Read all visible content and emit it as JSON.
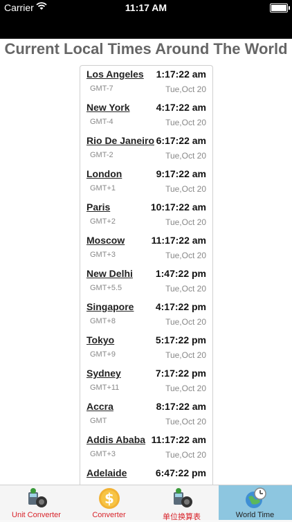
{
  "status": {
    "carrier": "Carrier",
    "time": "11:17 AM"
  },
  "title": "Current Local Times Around The World",
  "rows": [
    {
      "city": "Los Angeles",
      "time": "1:17:22 am",
      "gmt": "GMT-7",
      "date": "Tue,Oct 20"
    },
    {
      "city": "New York",
      "time": "4:17:22 am",
      "gmt": "GMT-4",
      "date": "Tue,Oct 20"
    },
    {
      "city": "Rio De Janeiro",
      "time": "6:17:22 am",
      "gmt": "GMT-2",
      "date": "Tue,Oct 20"
    },
    {
      "city": "London",
      "time": "9:17:22 am",
      "gmt": "GMT+1",
      "date": "Tue,Oct 20"
    },
    {
      "city": "Paris",
      "time": "10:17:22 am",
      "gmt": "GMT+2",
      "date": "Tue,Oct 20"
    },
    {
      "city": "Moscow",
      "time": "11:17:22 am",
      "gmt": "GMT+3",
      "date": "Tue,Oct 20"
    },
    {
      "city": "New Delhi",
      "time": "1:47:22 pm",
      "gmt": "GMT+5.5",
      "date": "Tue,Oct 20"
    },
    {
      "city": "Singapore",
      "time": "4:17:22 pm",
      "gmt": "GMT+8",
      "date": "Tue,Oct 20"
    },
    {
      "city": "Tokyo",
      "time": "5:17:22 pm",
      "gmt": "GMT+9",
      "date": "Tue,Oct 20"
    },
    {
      "city": "Sydney",
      "time": "7:17:22 pm",
      "gmt": "GMT+11",
      "date": "Tue,Oct 20"
    },
    {
      "city": "Accra",
      "time": "8:17:22 am",
      "gmt": "GMT",
      "date": "Tue,Oct 20"
    },
    {
      "city": "Addis Ababa",
      "time": "11:17:22 am",
      "gmt": "GMT+3",
      "date": "Tue,Oct 20"
    },
    {
      "city": "Adelaide",
      "time": "6:47:22 pm",
      "gmt": "",
      "date": ""
    }
  ],
  "tabs": [
    {
      "label": "Unit Converter",
      "icon": "unit-converter-icon",
      "selected": false
    },
    {
      "label": "Converter",
      "icon": "dollar-coin-icon",
      "selected": false
    },
    {
      "label": "单位换算表",
      "icon": "unit-table-icon",
      "selected": false
    },
    {
      "label": "World Time",
      "icon": "world-clock-icon",
      "selected": true
    }
  ],
  "colors": {
    "tab_label": "#d8232a",
    "tab_selected_bg": "#8dc6e0",
    "title": "#666666"
  }
}
